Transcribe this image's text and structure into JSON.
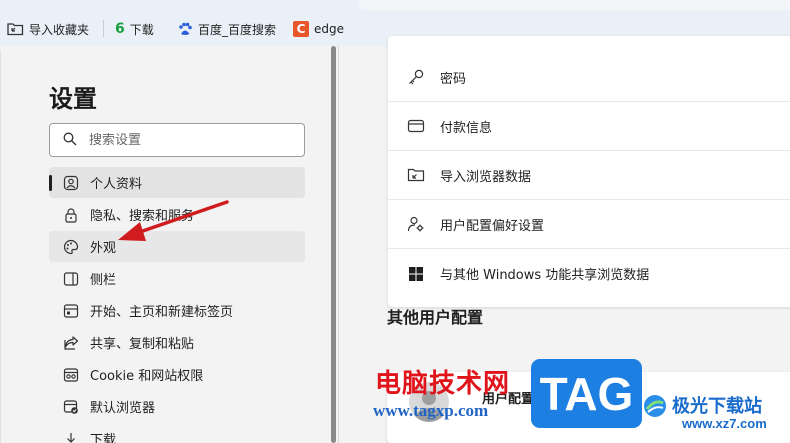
{
  "favorites_bar": {
    "items": [
      {
        "label": "导入收藏夹",
        "icon": "import-favorites-icon"
      },
      {
        "label": "下载",
        "icon": "download-6-icon"
      },
      {
        "label": "百度_百度搜索",
        "icon": "baidu-paw-icon"
      },
      {
        "label": "edge",
        "icon": "c-brand-icon"
      }
    ]
  },
  "sidebar": {
    "title": "设置",
    "search_placeholder": "搜索设置",
    "items": [
      {
        "label": "个人资料",
        "icon": "profile-icon",
        "state": "selected"
      },
      {
        "label": "隐私、搜索和服务",
        "icon": "lock-icon"
      },
      {
        "label": "外观",
        "icon": "palette-icon",
        "state": "hover"
      },
      {
        "label": "侧栏",
        "icon": "sidebar-icon"
      },
      {
        "label": "开始、主页和新建标签页",
        "icon": "home-grid-icon"
      },
      {
        "label": "共享、复制和粘贴",
        "icon": "share-icon"
      },
      {
        "label": "Cookie 和网站权限",
        "icon": "site-permissions-icon"
      },
      {
        "label": "默认浏览器",
        "icon": "default-browser-icon"
      },
      {
        "label": "下载",
        "icon": "download-icon"
      }
    ]
  },
  "content": {
    "rows": [
      {
        "label": "密码",
        "icon": "key-icon"
      },
      {
        "label": "付款信息",
        "icon": "credit-card-icon"
      },
      {
        "label": "导入浏览器数据",
        "icon": "import-folder-icon"
      },
      {
        "label": "用户配置偏好设置",
        "icon": "profile-settings-icon"
      },
      {
        "label": "与其他 Windows 功能共享浏览数据",
        "icon": "windows-icon"
      }
    ],
    "other_profiles_title": "其他用户配置",
    "other_profile_name": "用户配置 2"
  },
  "watermark": {
    "cn_text": "电脑技术网",
    "url": "www.tagxp.com",
    "tag_text": "TAG",
    "site_name": "极光下载站",
    "site_domain": "www.xz7.com"
  },
  "colors": {
    "favbar_bg": "#eaf0f7",
    "frame_bg": "#f3f3f3",
    "arrow": "#d01c1f",
    "tag_blue": "#1e7fe3",
    "wm_red": "#e0141b"
  }
}
